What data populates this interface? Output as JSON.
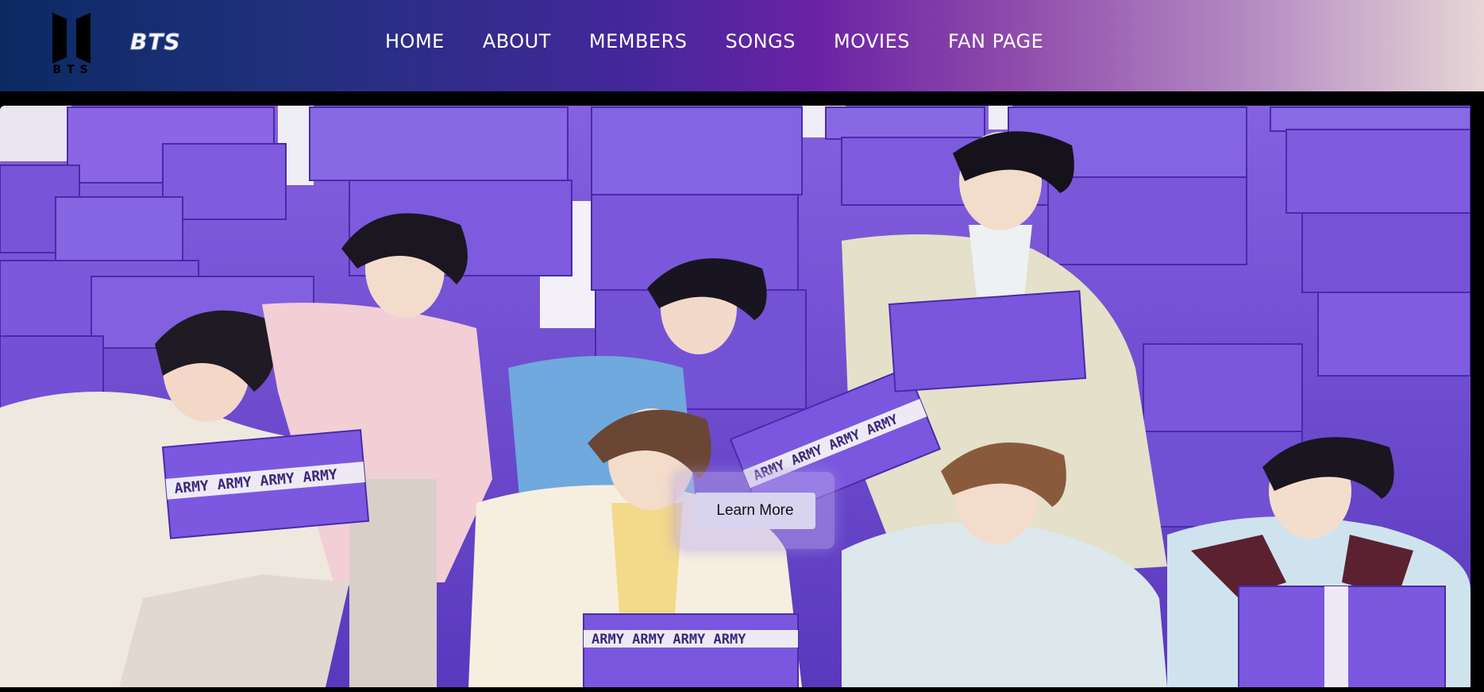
{
  "brand": {
    "logo_letters": "BTS",
    "name": "BTS"
  },
  "nav": {
    "items": [
      "HOME",
      "ABOUT",
      "MEMBERS",
      "SONGS",
      "MOVIES",
      "FAN PAGE"
    ]
  },
  "hero": {
    "button_label": "Learn More",
    "box_print": "ARMY ARMY ARMY ARMY"
  },
  "colors": {
    "box_purple": "#7b55dc",
    "box_purple_dark": "#5f3cc0"
  },
  "icons": {
    "logo": "bts-door-logo-icon"
  }
}
